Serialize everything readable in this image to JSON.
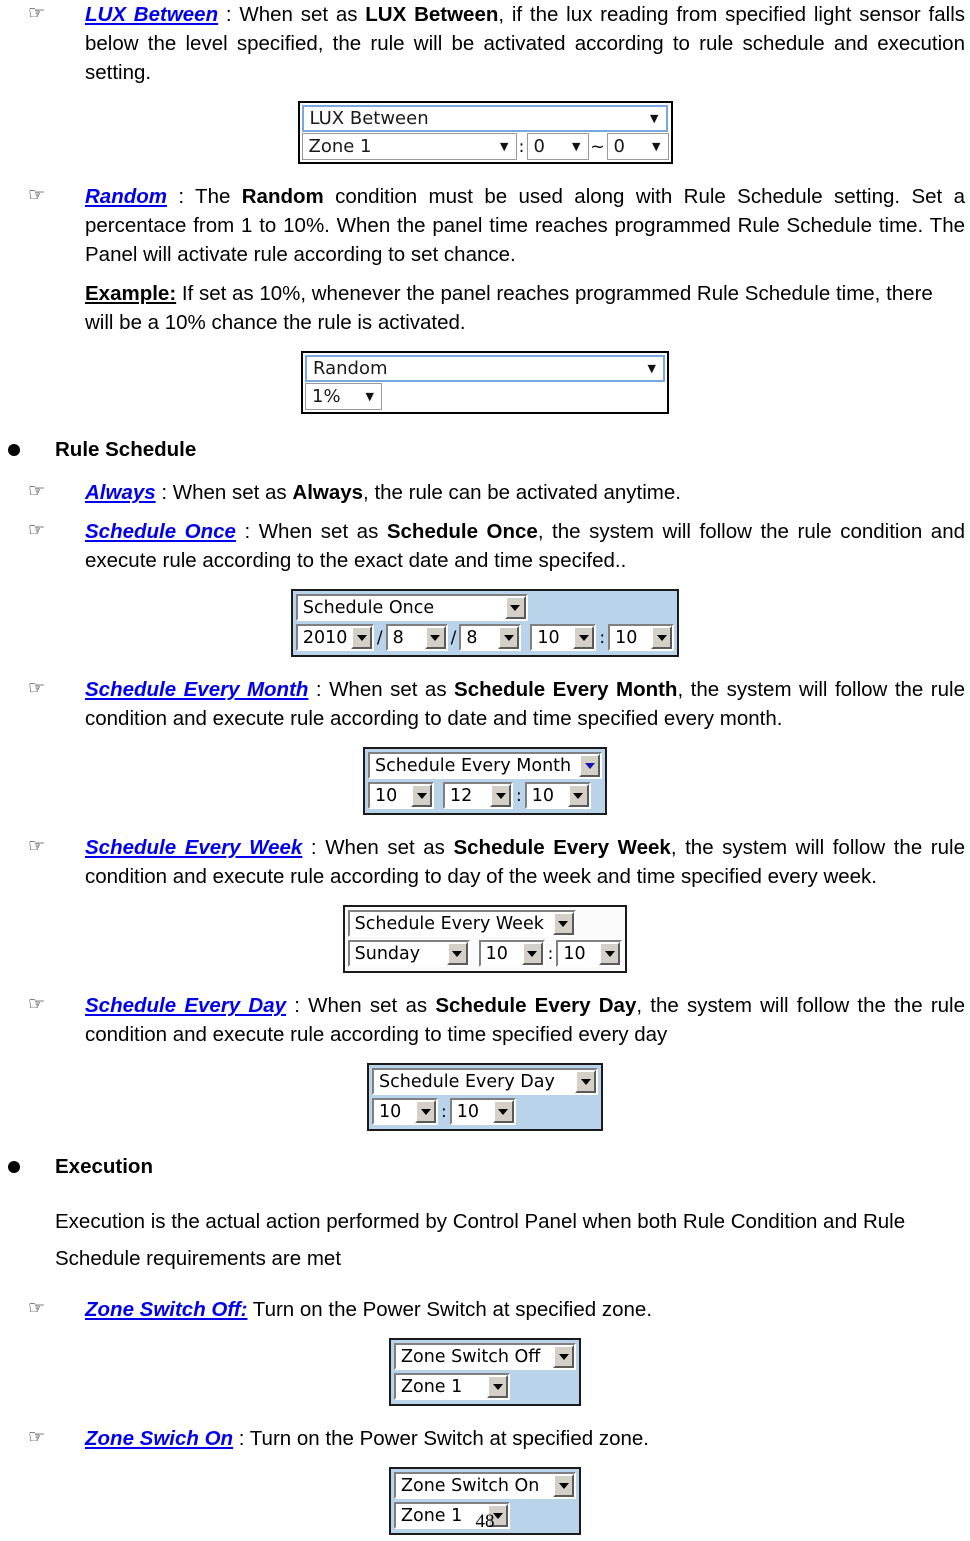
{
  "page": {
    "number": "48"
  },
  "icons": {
    "hand": "☞",
    "bullet": "bullet-dot",
    "caret_down": "▼"
  },
  "sections": [
    {
      "id": "lux-between",
      "term": "LUX Between",
      "body_1": " : When set as ",
      "body_bold": "LUX Between",
      "body_2": ", if the lux reading from specified light sensor falls below the level specified, the rule will be activated according to rule schedule and execution setting."
    },
    {
      "id": "random",
      "term": "Random",
      "body_1": " : The ",
      "body_bold": "Random",
      "body_2": " condition must be used along with Rule Schedule setting. Set a percentace from 1 to 10%. When the panel time reaches programmed Rule Schedule time. The Panel will activate rule according to set chance.",
      "example_label": "Example:",
      "example_text": " If set as 10%, whenever the panel reaches programmed Rule Schedule time, there will be a 10% chance the rule is activated."
    },
    {
      "id": "always",
      "term": "Always",
      "body_1": " : When set as ",
      "body_bold": "Always",
      "body_2": ", the rule can be activated anytime."
    },
    {
      "id": "schedule-once",
      "term": "Schedule Once",
      "body_1": " : When set as ",
      "body_bold": "Schedule Once",
      "body_2": ", the system will follow the rule condition and execute rule according to the exact date and time specifed.."
    },
    {
      "id": "schedule-every-month",
      "term": "Schedule Every Month",
      "body_1": " : When set as ",
      "body_bold": "Schedule Every Month",
      "body_2": ", the system will follow the rule condition and execute rule according to date and time specified every month."
    },
    {
      "id": "schedule-every-week",
      "term": "Schedule Every Week",
      "body_1": " : When set as ",
      "body_bold": "Schedule Every Week",
      "body_2": ", the system will follow the rule condition and execute rule according to day of the week and time specified every week."
    },
    {
      "id": "schedule-every-day",
      "term": "Schedule Every Day",
      "body_1": " : When set as ",
      "body_bold": "Schedule Every Day",
      "body_2": ", the system will follow the the rule condition and execute rule according to time specified every day"
    },
    {
      "id": "zone-switch-off",
      "term": "Zone Switch Off:",
      "body_1": " Turn on the Power Switch at specified zone.",
      "body_bold": "",
      "body_2": ""
    },
    {
      "id": "zone-swich-on",
      "term": "Zone Swich On",
      "body_1": " : Turn on the Power Switch at specified zone.",
      "body_bold": "",
      "body_2": ""
    }
  ],
  "headings": {
    "rule_schedule": "Rule Schedule",
    "execution": "Execution"
  },
  "execution_para": "Execution is the actual action performed by Control Panel when both Rule Condition and Rule Schedule requirements are met",
  "widgets": {
    "lux_between": {
      "style": "flat",
      "type_select": "LUX Between",
      "zone_select": "Zone 1",
      "separator_colon": ":",
      "min_value": "0",
      "range_separator": "~",
      "max_value": "0"
    },
    "random": {
      "style": "flat",
      "type_select": "Random",
      "percent_select": "1%"
    },
    "schedule_once": {
      "style": "classic",
      "type_select": "Schedule Once",
      "year": "2010",
      "date_sep_1": "/",
      "month": "8",
      "date_sep_2": "/",
      "day": "8",
      "hour": "10",
      "time_sep": ":",
      "minute": "10"
    },
    "schedule_every_month": {
      "style": "classic",
      "type_select": "Schedule Every Month",
      "day": "10",
      "hour": "12",
      "time_sep": ":",
      "minute": "10"
    },
    "schedule_every_week": {
      "style": "classic",
      "type_select": "Schedule Every Week",
      "weekday": "Sunday",
      "hour": "10",
      "time_sep": ":",
      "minute": "10"
    },
    "schedule_every_day": {
      "style": "classic",
      "type_select": "Schedule Every Day",
      "hour": "10",
      "time_sep": ":",
      "minute": "10"
    },
    "zone_switch_off": {
      "style": "classic",
      "type_select": "Zone Switch Off",
      "zone_select": "Zone 1"
    },
    "zone_switch_on": {
      "style": "classic",
      "type_select": "Zone Switch On",
      "zone_select": "Zone 1"
    }
  },
  "colors": {
    "link": "#0000ee",
    "panel_blue": "#b9d3ea",
    "classic_button_face": "#d4d0c8",
    "accent_border": "#7aa7e0"
  }
}
